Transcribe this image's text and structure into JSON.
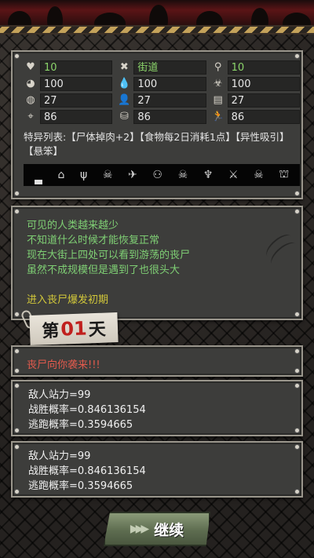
{
  "stats": [
    {
      "icon": "heart-icon",
      "glyph": "♥",
      "value": "10",
      "green": true
    },
    {
      "icon": "crossed-tools-icon",
      "glyph": "✖",
      "value": "街道",
      "green": true
    },
    {
      "icon": "location-pin-icon",
      "glyph": "⚲",
      "value": "10",
      "green": true
    },
    {
      "icon": "stomach-icon",
      "glyph": "◕",
      "value": "100",
      "green": false
    },
    {
      "icon": "water-drop-icon",
      "glyph": "💧",
      "value": "100",
      "green": false
    },
    {
      "icon": "biohazard-icon",
      "glyph": "☣",
      "value": "100",
      "green": false
    },
    {
      "icon": "brain-icon",
      "glyph": "◍",
      "value": "27",
      "green": false
    },
    {
      "icon": "person-icon",
      "glyph": "👤",
      "value": "27",
      "green": false
    },
    {
      "icon": "book-icon",
      "glyph": "▤",
      "value": "27",
      "green": false
    },
    {
      "icon": "crosshair-icon",
      "glyph": "⌖",
      "value": "86",
      "green": false
    },
    {
      "icon": "backpack-icon",
      "glyph": "⛁",
      "value": "86",
      "green": false
    },
    {
      "icon": "running-icon",
      "glyph": "🏃",
      "value": "86",
      "green": false
    }
  ],
  "traits": "特异列表:【尸体掉肉+2】【食物每2日消耗1点】【异性吸引】【悬笨】",
  "icon_strip": [
    {
      "name": "shop-icon",
      "glyph": "⌂"
    },
    {
      "name": "plant-icon",
      "glyph": "ψ"
    },
    {
      "name": "skull-icon",
      "glyph": "☠"
    },
    {
      "name": "airplane-icon",
      "glyph": "✈"
    },
    {
      "name": "group-icon",
      "glyph": "⚇"
    },
    {
      "name": "skull-icon-2",
      "glyph": "☠"
    },
    {
      "name": "zombie-hands-icon",
      "glyph": "♆"
    },
    {
      "name": "muscle-icon",
      "glyph": "⚔"
    },
    {
      "name": "skull-icon-3",
      "glyph": "☠"
    },
    {
      "name": "bank-icon",
      "glyph": "⛫"
    }
  ],
  "narrative": {
    "lines": [
      "可见的人类越来越少",
      "不知道什么时候才能恢复正常",
      "现在大街上四处可以看到游荡的丧尸",
      "虽然不成规模但是遇到了也很头大"
    ],
    "phase": "进入丧尸爆发初期"
  },
  "day": {
    "prefix": "第",
    "number": "01",
    "suffix": "天"
  },
  "alert": "丧尸向你袭来!!!",
  "battles": [
    {
      "enemy": "敌人站力=99",
      "win": "战胜概率=0.846136154",
      "escape": "逃跑概率=0.3594665"
    },
    {
      "enemy": "敌人站力=99",
      "win": "战胜概率=0.846136154",
      "escape": "逃跑概率=0.3594665"
    }
  ],
  "continue_label": "继续"
}
